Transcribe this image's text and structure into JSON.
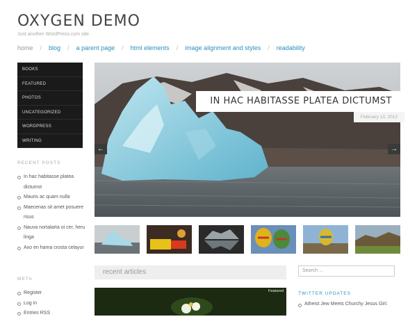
{
  "site": {
    "title": "OXYGEN DEMO",
    "description": "Just another WordPress.com site"
  },
  "nav": {
    "items": [
      "home",
      "blog",
      "a parent page",
      "html elements",
      "image alignment and styles",
      "readability"
    ],
    "separator": "/"
  },
  "categories": [
    "BOOKS",
    "FEATURED",
    "PHOTOS",
    "UNCATEGORIZED",
    "WORDPRESS",
    "WRITING"
  ],
  "recent_posts": {
    "title": "RECENT POSTS",
    "items": [
      "In hac habitasse platea dictumst",
      "Mauris ac quam nulla",
      "Maecenas sit amet posuere risus",
      "Nauva nortalarta oi cer, heru linga",
      "Axo en hama crosta celayur"
    ]
  },
  "meta": {
    "title": "META",
    "items": [
      "Register",
      "Log in",
      "Entries RSS"
    ]
  },
  "slider": {
    "caption_title": "IN HAC HABITASSE PLATEA DICTUMST",
    "caption_date": "February 13, 2012",
    "prev": "←",
    "next": "→"
  },
  "recent_articles": {
    "label": "recent articles",
    "featured_tag": "Featured"
  },
  "search": {
    "placeholder": "Search ..."
  },
  "twitter": {
    "title": "TWITTER UPDATES",
    "items": [
      "Atheist Jew Meets Churchy Jesus Girl."
    ]
  },
  "colors": {
    "accent": "#2a8fbd",
    "menu_bg": "#1a1a1a"
  }
}
